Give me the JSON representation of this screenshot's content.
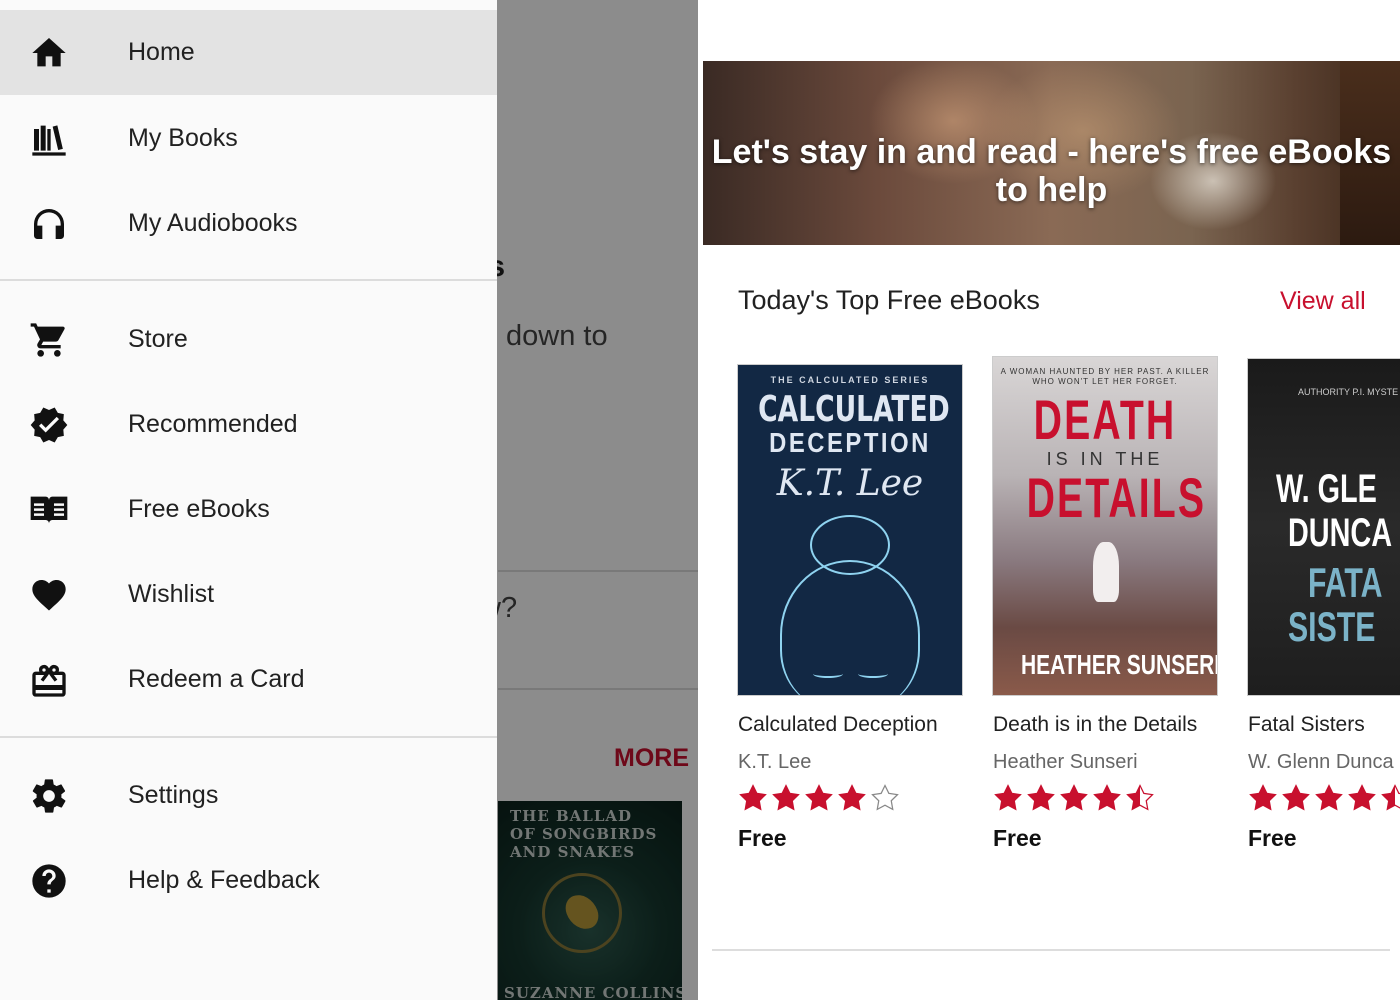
{
  "drawer": {
    "items": [
      {
        "label": "Home",
        "icon": "home-icon"
      },
      {
        "label": "My Books",
        "icon": "library-icon"
      },
      {
        "label": "My Audiobooks",
        "icon": "headphones-icon"
      },
      {
        "label": "Store",
        "icon": "cart-icon"
      },
      {
        "label": "Recommended",
        "icon": "verified-badge-icon"
      },
      {
        "label": "Free eBooks",
        "icon": "open-book-icon"
      },
      {
        "label": "Wishlist",
        "icon": "heart-icon"
      },
      {
        "label": "Redeem a Card",
        "icon": "gift-card-icon"
      },
      {
        "label": "Settings",
        "icon": "gear-icon"
      },
      {
        "label": "Help & Feedback",
        "icon": "help-icon"
      }
    ]
  },
  "behind": {
    "heading_fragment": "ns",
    "sub_fragment": "down to",
    "question_fragment": "w?",
    "more_label": "MORE",
    "cover_title": "THE BALLAD OF SONGBIRDS AND SNAKES",
    "cover_author": "SUZANNE COLLINS"
  },
  "store": {
    "banner_headline": "Let's stay in and read - here's free eBooks to help",
    "section_title": "Today's Top Free eBooks",
    "view_all": "View all",
    "books": [
      {
        "title": "Calculated Deception",
        "author": "K.T. Lee",
        "rating": 4,
        "price": "Free",
        "cover": {
          "series": "THE CALCULATED SERIES",
          "line1": "CALCULATED",
          "line2": "DECEPTION",
          "author": "K.T. Lee"
        }
      },
      {
        "title": "Death is in the Details",
        "author": "Heather Sunseri",
        "rating": 4.5,
        "price": "Free",
        "cover": {
          "tagline": "A WOMAN HAUNTED BY HER PAST. A KILLER WHO WON'T LET HER FORGET.",
          "line1": "DEATH",
          "line2": "IS IN THE",
          "line3": "DETAILS",
          "author": "HEATHER SUNSERI"
        }
      },
      {
        "title": "Fatal Sisters",
        "author": "W. Glenn Dunca",
        "rating": 4.5,
        "price": "Free",
        "cover": {
          "tagline": "AUTHORITY P.I. MYSTE",
          "line1": "W. GLE",
          "line2": "DUNCA",
          "line3": "FATA",
          "line4": "SISTE"
        }
      }
    ]
  },
  "colors": {
    "accent": "#c8102e",
    "star": "#c8102e",
    "drawer_bg": "#fafafa",
    "active_bg": "#e3e3e3"
  }
}
